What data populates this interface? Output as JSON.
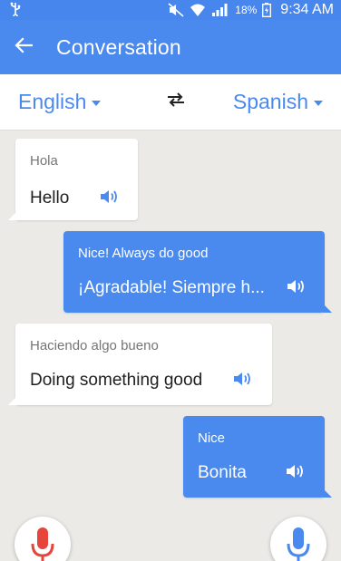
{
  "status_bar": {
    "battery": "18%",
    "time": "9:34 AM",
    "icons": [
      "usb-icon",
      "mute-icon",
      "wifi-icon",
      "signal-icon",
      "battery-icon"
    ]
  },
  "app_bar": {
    "title": "Conversation",
    "back_icon": "arrow-back-icon"
  },
  "languages": {
    "source": "English",
    "target": "Spanish",
    "swap_icon": "swap-icon"
  },
  "messages": [
    {
      "side": "left",
      "original": "Hola",
      "translation": "Hello"
    },
    {
      "side": "right",
      "original": "Nice! Always do good",
      "translation": "¡Agradable! Siempre h..."
    },
    {
      "side": "left",
      "original": "Haciendo algo bueno",
      "translation": "Doing something good"
    },
    {
      "side": "right",
      "original": "Nice",
      "translation": "Bonita"
    }
  ],
  "mics": {
    "left_color": "#e5453b",
    "right_color": "#4a89ee"
  },
  "colors": {
    "accent": "#4a89ee",
    "background": "#eceae7"
  }
}
